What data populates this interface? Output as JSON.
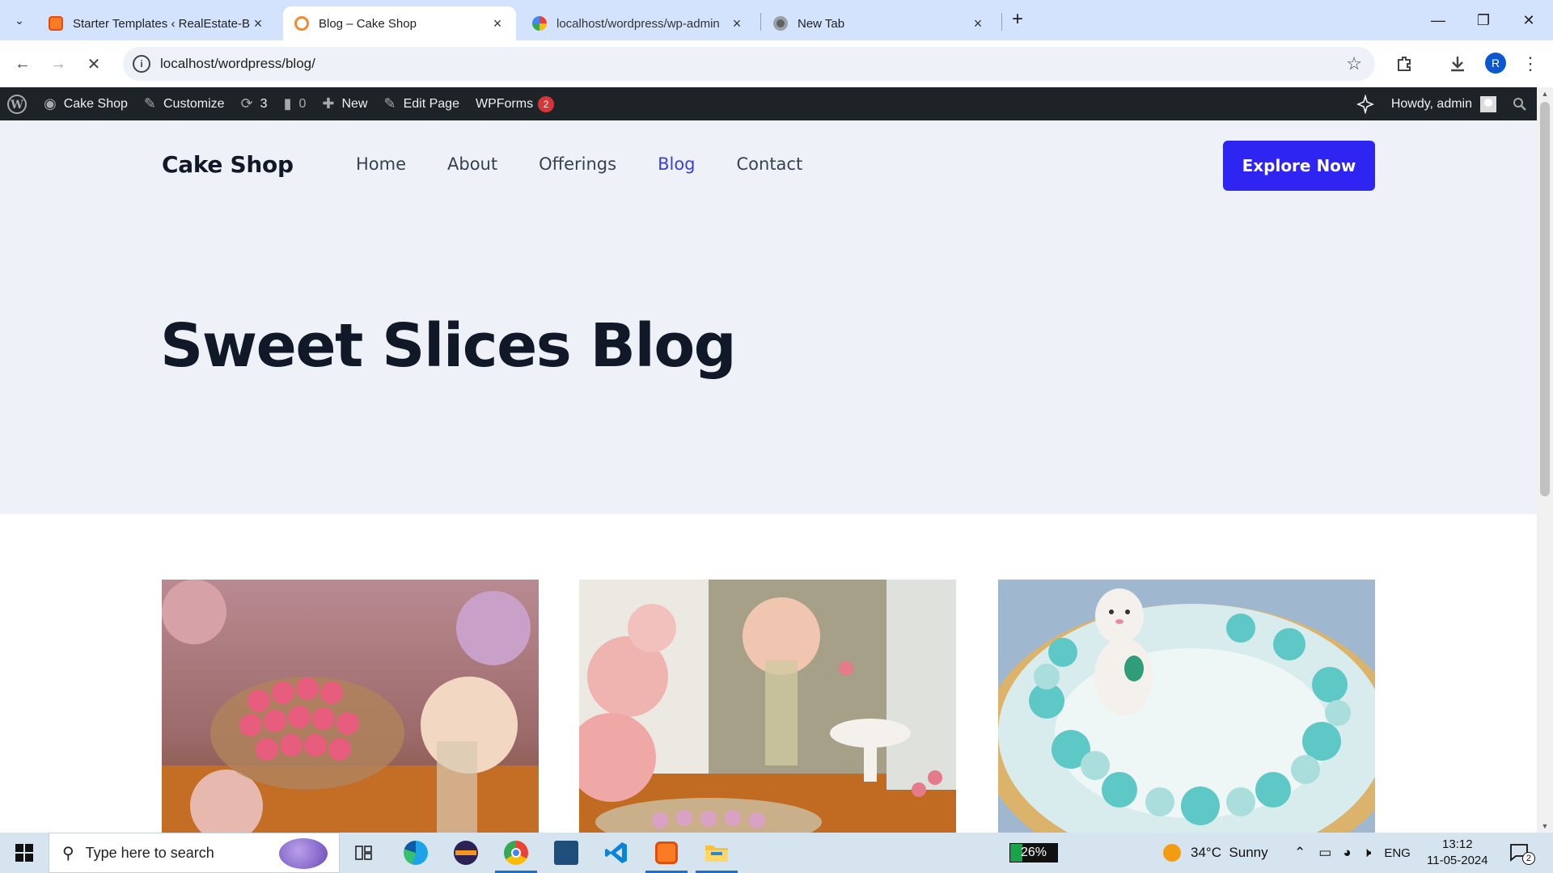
{
  "browser": {
    "tabs": [
      {
        "title": "Starter Templates ‹ RealEstate-B",
        "icon": "xampp-icon",
        "active": false
      },
      {
        "title": "Blog – Cake Shop",
        "icon": "wordpress-loading-icon",
        "active": true
      },
      {
        "title": "localhost/wordpress/wp-admin",
        "icon": "google-icon",
        "active": false
      },
      {
        "title": "New Tab",
        "icon": "chrome-icon",
        "active": false
      }
    ],
    "url": "localhost/wordpress/blog/",
    "profile_initial": "R"
  },
  "adminbar": {
    "site_name": "Cake Shop",
    "customize": "Customize",
    "updates_count": "3",
    "comments_count": "0",
    "new_label": "New",
    "edit_page": "Edit Page",
    "wpforms": "WPForms",
    "wpforms_badge": "2",
    "howdy": "Howdy, admin"
  },
  "site": {
    "title": "Cake Shop",
    "nav": [
      "Home",
      "About",
      "Offerings",
      "Blog",
      "Contact"
    ],
    "current_nav": "Blog",
    "cta": "Explore Now",
    "heading": "Sweet Slices Blog",
    "accent_color": "#2f25f2",
    "hero_bg": "#eef2f8"
  },
  "posts": [
    {
      "image": "pink-cupcakes-on-glass-stand-photo"
    },
    {
      "image": "wedding-dessert-table-photo"
    },
    {
      "image": "teal-buttercream-cake-with-bunny-photo"
    }
  ],
  "taskbar": {
    "search_placeholder": "Type here to search",
    "battery": "26%",
    "weather": "34°C  Sunny",
    "lang": "ENG",
    "time": "13:12",
    "date": "11-05-2024",
    "notifications": "2"
  }
}
